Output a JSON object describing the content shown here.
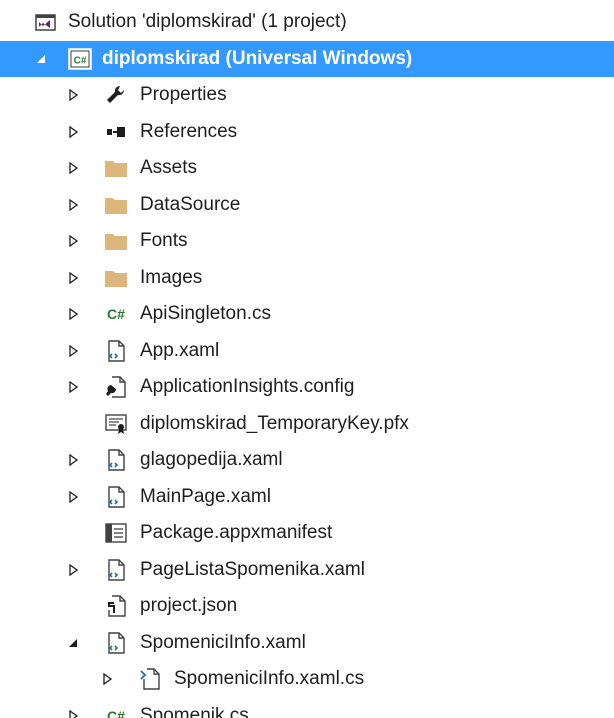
{
  "solution": {
    "label": "Solution 'diplomskirad' (1 project)"
  },
  "project": {
    "label": "diplomskirad (Universal Windows)",
    "icon": "csharp-project-icon"
  },
  "items": [
    {
      "label": "Properties",
      "icon": "wrench-icon"
    },
    {
      "label": "References",
      "icon": "references-icon"
    },
    {
      "label": "Assets",
      "icon": "folder-icon"
    },
    {
      "label": "DataSource",
      "icon": "folder-icon"
    },
    {
      "label": "Fonts",
      "icon": "folder-icon"
    },
    {
      "label": "Images",
      "icon": "folder-icon"
    },
    {
      "label": "ApiSingleton.cs",
      "icon": "csharp-file-icon",
      "glyph": "C#"
    },
    {
      "label": "App.xaml",
      "icon": "xaml-file-icon"
    },
    {
      "label": "ApplicationInsights.config",
      "icon": "config-file-icon"
    },
    {
      "label": "diplomskirad_TemporaryKey.pfx",
      "icon": "certificate-file-icon"
    },
    {
      "label": "glagopedija.xaml",
      "icon": "xaml-file-icon"
    },
    {
      "label": "MainPage.xaml",
      "icon": "xaml-file-icon"
    },
    {
      "label": "Package.appxmanifest",
      "icon": "manifest-file-icon"
    },
    {
      "label": "PageListaSpomenika.xaml",
      "icon": "xaml-file-icon"
    },
    {
      "label": "project.json",
      "icon": "json-file-icon"
    },
    {
      "label": "SpomeniciInfo.xaml",
      "icon": "xaml-file-icon"
    },
    {
      "label": "SpomeniciInfo.xaml.cs",
      "icon": "csharp-codebehind-icon"
    },
    {
      "label": "Spomenik.cs",
      "icon": "csharp-file-icon",
      "glyph": "C#"
    }
  ],
  "colors": {
    "selection": "#3399ff",
    "folder": "#dcb67a",
    "csharp": "#2b7a33",
    "vs_purple": "#68217a",
    "xaml_blue": "#1f6fb5"
  }
}
